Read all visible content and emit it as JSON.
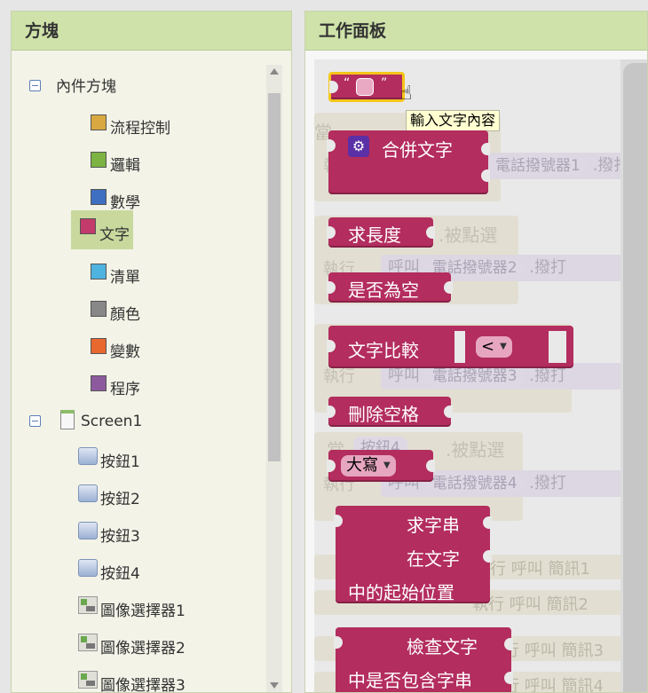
{
  "blocks_panel": {
    "title": "方塊",
    "builtin_group": "內件方塊",
    "categories": [
      {
        "label": "流程控制",
        "color": "#d9a840"
      },
      {
        "label": "邏輯",
        "color": "#7cb342"
      },
      {
        "label": "數學",
        "color": "#3f6fc1"
      },
      {
        "label": "文字",
        "color": "#c23b6a"
      },
      {
        "label": "清單",
        "color": "#4fb3e0"
      },
      {
        "label": "顏色",
        "color": "#888888"
      },
      {
        "label": "變數",
        "color": "#e8682e"
      },
      {
        "label": "程序",
        "color": "#8e5a9e"
      }
    ],
    "selected_category": "文字",
    "screen": {
      "label": "Screen1",
      "components": [
        {
          "label": "按鈕1",
          "icon": "button-icon"
        },
        {
          "label": "按鈕2",
          "icon": "button-icon"
        },
        {
          "label": "按鈕3",
          "icon": "button-icon"
        },
        {
          "label": "按鈕4",
          "icon": "button-icon"
        },
        {
          "label": "圖像選擇器1",
          "icon": "image-picker-icon"
        },
        {
          "label": "圖像選擇器2",
          "icon": "image-picker-icon"
        },
        {
          "label": "圖像選擇器3",
          "icon": "image-picker-icon"
        }
      ]
    }
  },
  "workspace": {
    "title": "工作面板",
    "tooltip": "輸入文字內容",
    "string_block": {
      "open_quote": "“",
      "close_quote": "”"
    },
    "join_block": {
      "label": "合併文字"
    },
    "length_block": {
      "label": "求長度"
    },
    "is_empty_block": {
      "label": "是否為空"
    },
    "compare_block": {
      "label": "文字比較",
      "operator": "<"
    },
    "trim_block": {
      "label": "刪除空格"
    },
    "case_block": {
      "option": "大寫"
    },
    "starts_at_block": {
      "line1": "求字串",
      "line2": "在文字",
      "line3": "中的起始位置"
    },
    "contains_block": {
      "line1": "檢查文字",
      "line2": "中是否包含字串"
    },
    "ghost": {
      "when": "當",
      "do": "執行",
      "call": "呼叫",
      "button4": "按鈕4",
      "click": ".被點選",
      "dialer1": "電話撥號器1",
      "dialer2": "電話撥號器2",
      "dialer3": "電話撥號器3",
      "dialer4": "電話撥號器4",
      "dial": ".撥打",
      "sms1": "行 呼叫 簡訊1",
      "sms2": "執行 呼叫 簡訊2",
      "sms3": "行 呼叫 簡訊3",
      "sms4": "行 呼叫 簡訊4"
    }
  }
}
